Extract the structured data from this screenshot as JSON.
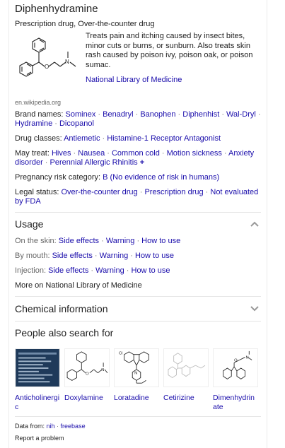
{
  "header": {
    "title": "Diphenhydramine",
    "subtitle": "Prescription drug, Over-the-counter drug"
  },
  "description": {
    "text": "Treats pain and itching caused by insect bites, minor cuts or burns, or sunburn. Also treats skin rash caused by poison ivy, poison oak, or poison sumac.",
    "source": "National Library of Medicine"
  },
  "image_source": "en.wikipedia.org",
  "facts": {
    "brand_names": {
      "label": "Brand names:",
      "values": [
        "Sominex",
        "Benadryl",
        "Banophen",
        "Diphenhist",
        "Wal-Dryl",
        "Hydramine",
        "Dicopanol"
      ]
    },
    "drug_classes": {
      "label": "Drug classes:",
      "values": [
        "Antiemetic",
        "Histamine-1 Receptor Antagonist"
      ]
    },
    "may_treat": {
      "label": "May treat:",
      "values": [
        "Hives",
        "Nausea",
        "Common cold",
        "Motion sickness",
        "Anxiety disorder",
        "Perennial Allergic Rhinitis"
      ],
      "more": "+"
    },
    "pregnancy": {
      "label": "Pregnancy risk category:",
      "value": "B (No evidence of risk in humans)"
    },
    "legal_status": {
      "label": "Legal status:",
      "values": [
        "Over-the-counter drug",
        "Prescription drug",
        "Not evaluated by FDA"
      ]
    }
  },
  "usage": {
    "title": "Usage",
    "rows": [
      {
        "label": "On the skin:",
        "links": [
          "Side effects",
          "Warning",
          "How to use"
        ]
      },
      {
        "label": "By mouth:",
        "links": [
          "Side effects",
          "Warning",
          "How to use"
        ]
      },
      {
        "label": "Injection:",
        "links": [
          "Side effects",
          "Warning",
          "How to use"
        ]
      }
    ],
    "more_link": "More on National Library of Medicine"
  },
  "chemical": {
    "title": "Chemical information"
  },
  "people_also_search": {
    "title": "People also search for",
    "items": [
      {
        "name": "Anticholinergic"
      },
      {
        "name": "Doxylamine"
      },
      {
        "name": "Loratadine"
      },
      {
        "name": "Cetirizine"
      },
      {
        "name": "Dimenhydrinate"
      }
    ]
  },
  "footer": {
    "data_from_label": "Data from:",
    "sources": [
      "nih",
      "freebase"
    ],
    "report": "Report a problem"
  },
  "colors": {
    "link": "#1a0dab",
    "text": "#222222",
    "muted": "#666666",
    "divider": "#e5e5e5"
  }
}
